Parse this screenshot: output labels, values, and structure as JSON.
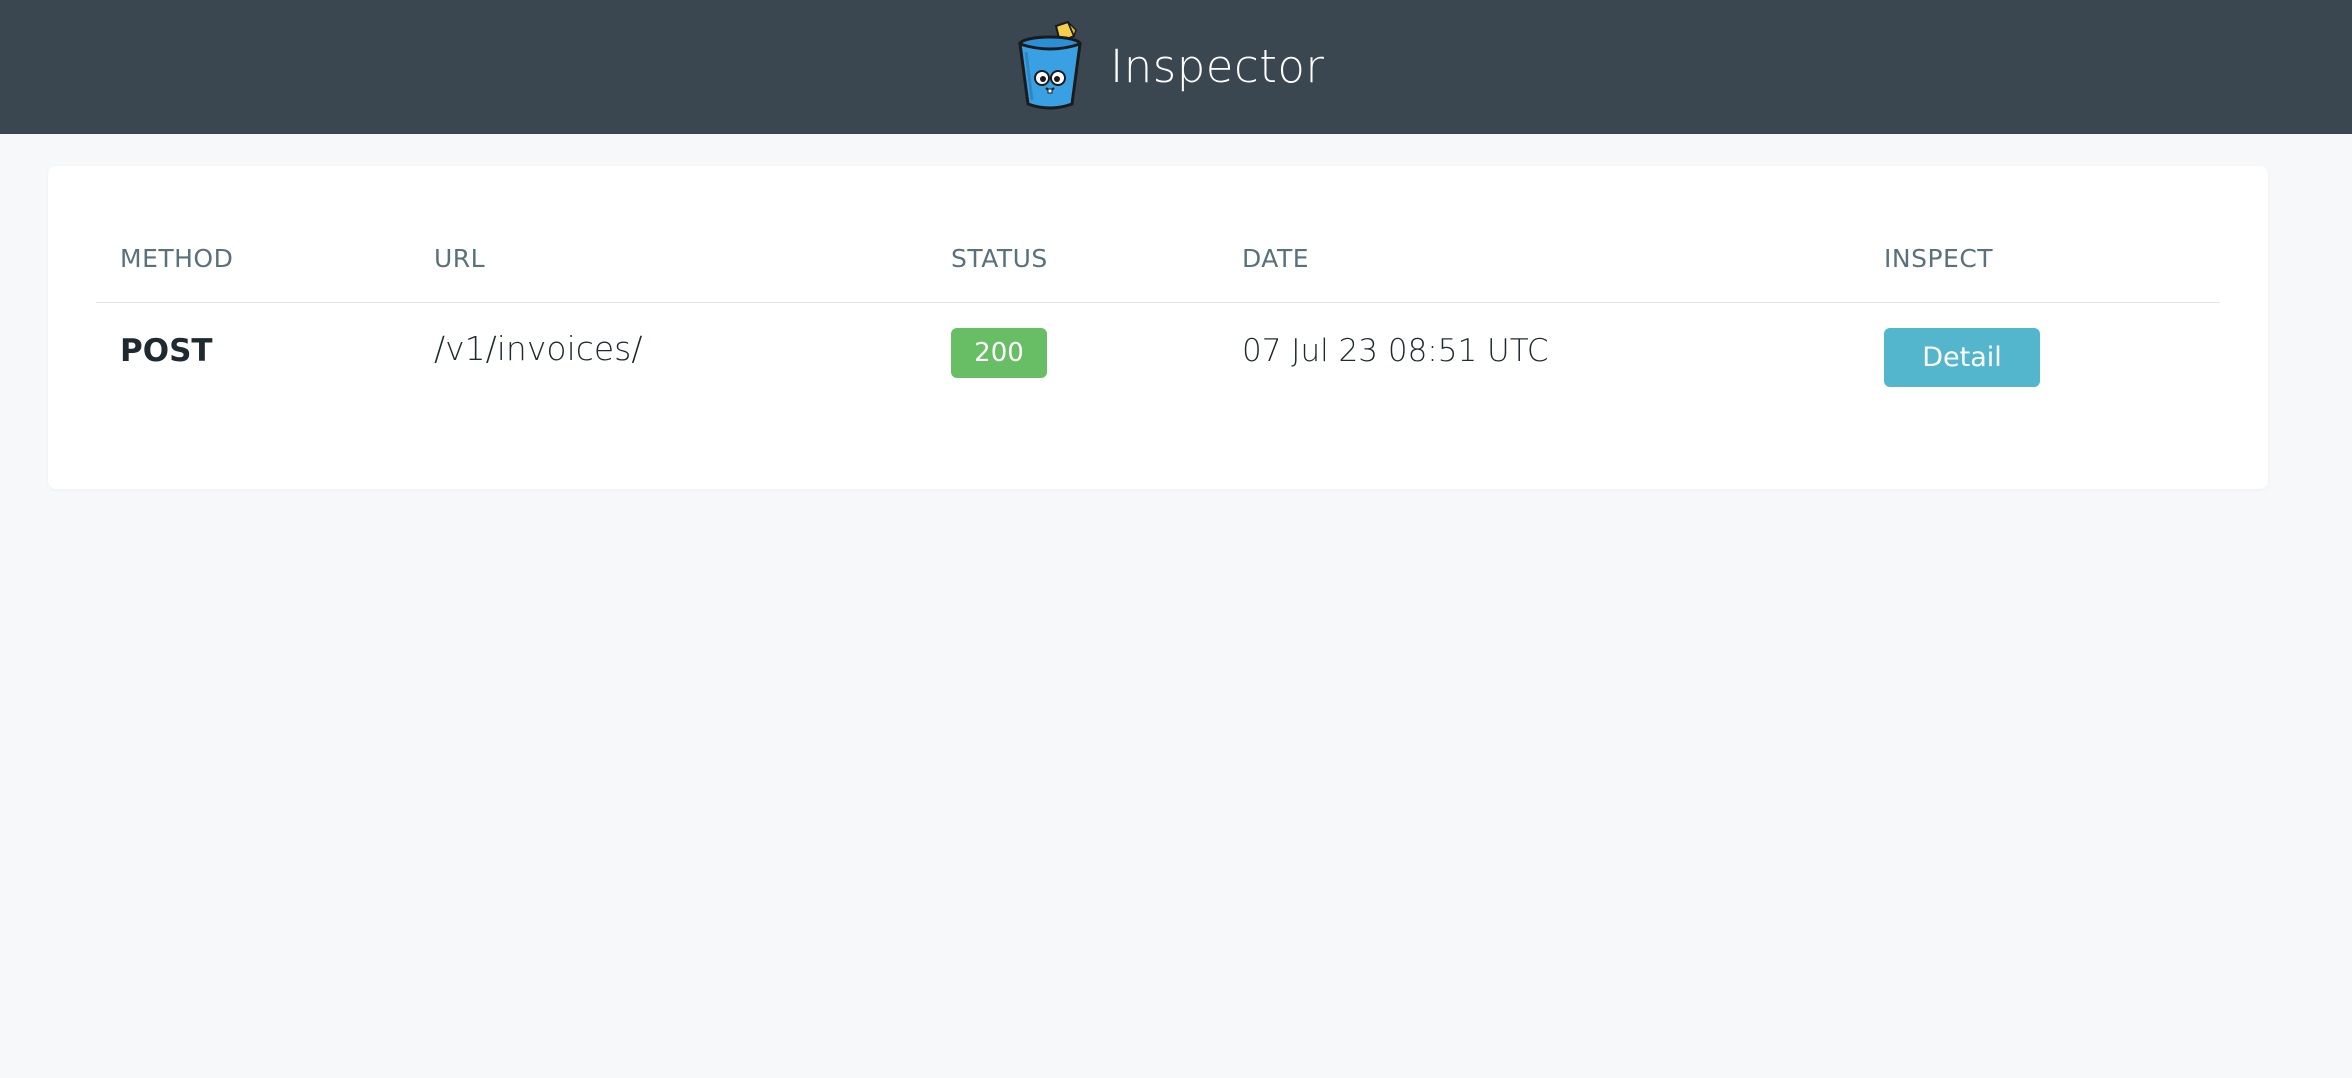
{
  "header": {
    "title": "Inspector",
    "logo_icon": "bucket-mascot-icon"
  },
  "table": {
    "columns": [
      "METHOD",
      "URL",
      "STATUS",
      "DATE",
      "INSPECT"
    ],
    "rows": [
      {
        "method": "POST",
        "url": "/v1/invoices/",
        "status": "200",
        "date": "07 Jul 23 08:51 UTC",
        "inspect_label": "Detail"
      }
    ]
  },
  "colors": {
    "header_bg": "#3a4750",
    "status_success": "#67be64",
    "button_info": "#54b6cc"
  }
}
